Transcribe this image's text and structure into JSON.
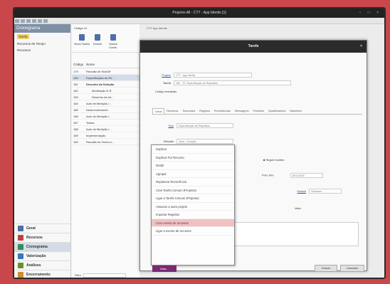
{
  "window": {
    "title": "Projetos All - CTT - App Identis [1]",
    "controls": "– □ ×"
  },
  "sidebar": {
    "header": "Cronograma",
    "items": [
      {
        "label": "Tarefa"
      },
      {
        "label": "Recursos de Tempo"
      },
      {
        "label": "Recursos"
      }
    ],
    "nav": [
      {
        "label": "Geral",
        "color": "#4e6fa8"
      },
      {
        "label": "Recursos",
        "color": "#b9463c"
      },
      {
        "label": "Cronograma",
        "color": "#2f8f5a"
      },
      {
        "label": "Valorização",
        "color": "#3a78b8"
      },
      {
        "label": "Análises",
        "color": "#6b8f2f"
      },
      {
        "label": "Encerramento",
        "color": "#d08c2c"
      }
    ]
  },
  "middle": {
    "top_field": "Código  10",
    "ribbon": [
      {
        "label": "Nova Tarefa"
      },
      {
        "label": "Excluir"
      },
      {
        "label": "Dados Comb."
      }
    ],
    "columns": [
      "Código",
      "Nome"
    ],
    "rows": [
      {
        "code": "179",
        "name": "Reunião de KickOff"
      },
      {
        "code": "180",
        "name": "Especificação de Re..."
      },
      {
        "code": "181",
        "name": "Desenho da Solução"
      },
      {
        "code": "182",
        "name": "Modelação E-R"
      },
      {
        "code": "183",
        "name": "Desenho da Int..."
      },
      {
        "code": "184",
        "name": "Auto de Medição /..."
      },
      {
        "code": "185",
        "name": "Desenvolvimento"
      },
      {
        "code": "186",
        "name": "Auto de Medição /..."
      },
      {
        "code": "187",
        "name": "Testes"
      },
      {
        "code": "188",
        "name": "Auto de Medição /..."
      },
      {
        "code": "189",
        "name": "Implementação"
      },
      {
        "code": "190",
        "name": "Reunião de Fecho e..."
      }
    ],
    "filter_label": "Filtro"
  },
  "right": {
    "header": "CTT   App Identis"
  },
  "dialog": {
    "title": "Tarefa",
    "close": "×",
    "fields": {
      "projeto_label": "Projeto",
      "projeto_value": "CTT - App Identis",
      "tarefa_label": "Tarefa",
      "tarefa_code": "180",
      "tarefa_value": "Especificação de Requisitos",
      "codigo_label": "Código resultado",
      "tipo_label": "Tipo",
      "tipo_value": "Especificação de Requisitos",
      "selecao_label": "Seleção",
      "selecao_value": "Nova · Duração",
      "dependent_label": "Depende de",
      "check_label": "Seguir modelo",
      "prev_label": "Prev. fimi",
      "prev_value": "28/11/2016",
      "estado_label": "Estado",
      "estado_value": "Planeado",
      "valor_label": "Valor"
    },
    "tabs": [
      "Geral",
      "Recursos",
      "Tesouraria",
      "Registos",
      "Precedências",
      "Mensagens",
      "Previstos",
      "Qualificadores",
      "Baselines"
    ],
    "footer": {
      "more": "Mais...",
      "save": "Gravar",
      "cancel": "Cancelar"
    }
  },
  "context_menu": {
    "items": [
      {
        "label": "Duplicar"
      },
      {
        "label": "Duplicar Por Recurso"
      },
      {
        "label": "Dividir"
      },
      {
        "label": "Agrupar"
      },
      {
        "label": "Replanear Recorrência"
      },
      {
        "label": "Criar Tarefa Comum (Projetos)"
      },
      {
        "label": "Ligar a Tarefa Comum (Projetos)"
      },
      {
        "label": "Associar a outro projeto"
      },
      {
        "label": "Importar Registos"
      },
      {
        "label": "Criar evento de recursos"
      },
      {
        "label": "Ligar a evento de recursos"
      }
    ],
    "highlighted_index": 9,
    "highlight_color": "#f3c0c1"
  }
}
